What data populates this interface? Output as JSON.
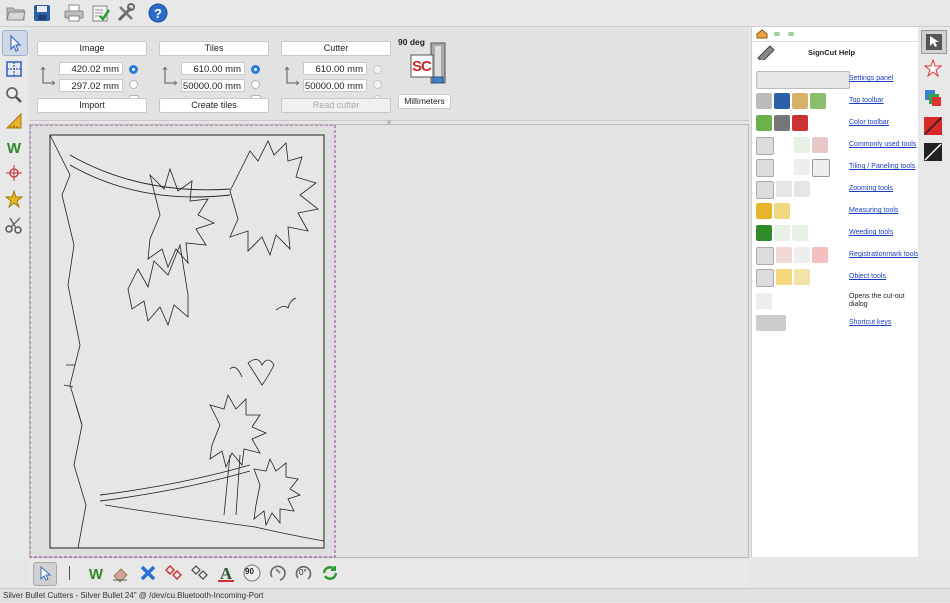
{
  "settings": {
    "image": {
      "label": "Image",
      "width": "420.02 mm",
      "height": "297.02 mm",
      "action": "Import"
    },
    "tiles": {
      "label": "Tiles",
      "width": "610.00 mm",
      "height": "50000.00 mm",
      "action": "Create tiles"
    },
    "cutter": {
      "label": "Cutter",
      "width": "610.00 mm",
      "height": "50000.00 mm",
      "action": "Read cutter"
    },
    "rotation": "90 deg",
    "units": "Millimeters",
    "logo_text": "SC"
  },
  "help": {
    "title": "SignCut Help",
    "items": [
      {
        "label": "Settings panel",
        "link": true
      },
      {
        "label": "Top toolbar",
        "link": true
      },
      {
        "label": "Color toolbar",
        "link": true
      },
      {
        "label": "Commonly used tools",
        "link": true
      },
      {
        "label": "Tiling / Paneling tools",
        "link": true
      },
      {
        "label": "Zooming tools",
        "link": true
      },
      {
        "label": "Measuring tools",
        "link": true
      },
      {
        "label": "Weeding tools",
        "link": true
      },
      {
        "label": "Registrationmark tools",
        "link": true
      },
      {
        "label": "Object tools",
        "link": true
      },
      {
        "label": "Opens the cut-out dialog",
        "link": false
      },
      {
        "label": "Shortcut keys",
        "link": true
      }
    ]
  },
  "bottom_toolbar": {
    "rotate_label": "90",
    "angle_label": "0°"
  },
  "status": "Silver Bullet Cutters - Silver Bullet 24\" @ /dev/cu.Bluetooth-Incoming-Port",
  "icons": {
    "top": [
      "open-folder-icon",
      "save-icon",
      "print-icon",
      "checklist-icon",
      "tools-icon",
      "help-icon"
    ],
    "left": [
      "pointer-icon",
      "tiling-icon",
      "zoom-icon",
      "measure-icon",
      "weed-icon",
      "regmark-icon",
      "star-object-icon",
      "scissors-icon"
    ],
    "right": [
      "cursor-color-icon",
      "star-outline-icon",
      "layers-color-icon",
      "red-line-icon",
      "black-line-icon"
    ]
  },
  "colors": {
    "accent": "#2a7bd8",
    "link": "#1a3fbf",
    "weed_green": "#2f8a2a",
    "red": "#d33a3a",
    "blue_x": "#2a6fd8"
  }
}
